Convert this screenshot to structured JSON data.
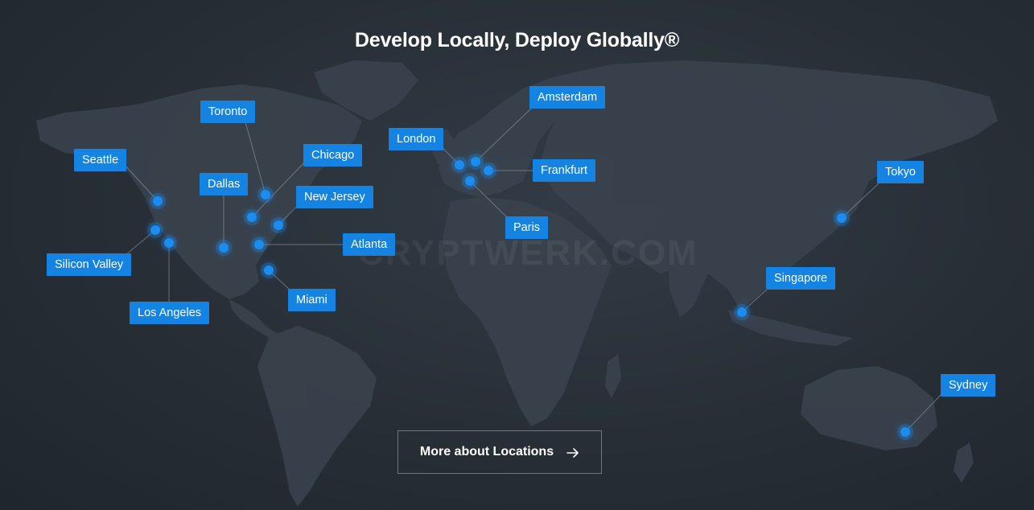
{
  "heading": "Develop Locally, Deploy Globally®",
  "watermark": "CRYPTWERK.COM",
  "colors": {
    "background": "#272e36",
    "land": "#3b444e",
    "accent": "#1483e2",
    "marker": "#1b8cf0"
  },
  "locations": [
    {
      "name": "Seattle"
    },
    {
      "name": "Silicon Valley"
    },
    {
      "name": "Los Angeles"
    },
    {
      "name": "Dallas"
    },
    {
      "name": "Toronto"
    },
    {
      "name": "Chicago"
    },
    {
      "name": "New Jersey"
    },
    {
      "name": "Atlanta"
    },
    {
      "name": "Miami"
    },
    {
      "name": "London"
    },
    {
      "name": "Amsterdam"
    },
    {
      "name": "Frankfurt"
    },
    {
      "name": "Paris"
    },
    {
      "name": "Tokyo"
    },
    {
      "name": "Singapore"
    },
    {
      "name": "Sydney"
    }
  ],
  "cta": {
    "label": "More about Locations",
    "icon": "arrow-right-icon"
  }
}
